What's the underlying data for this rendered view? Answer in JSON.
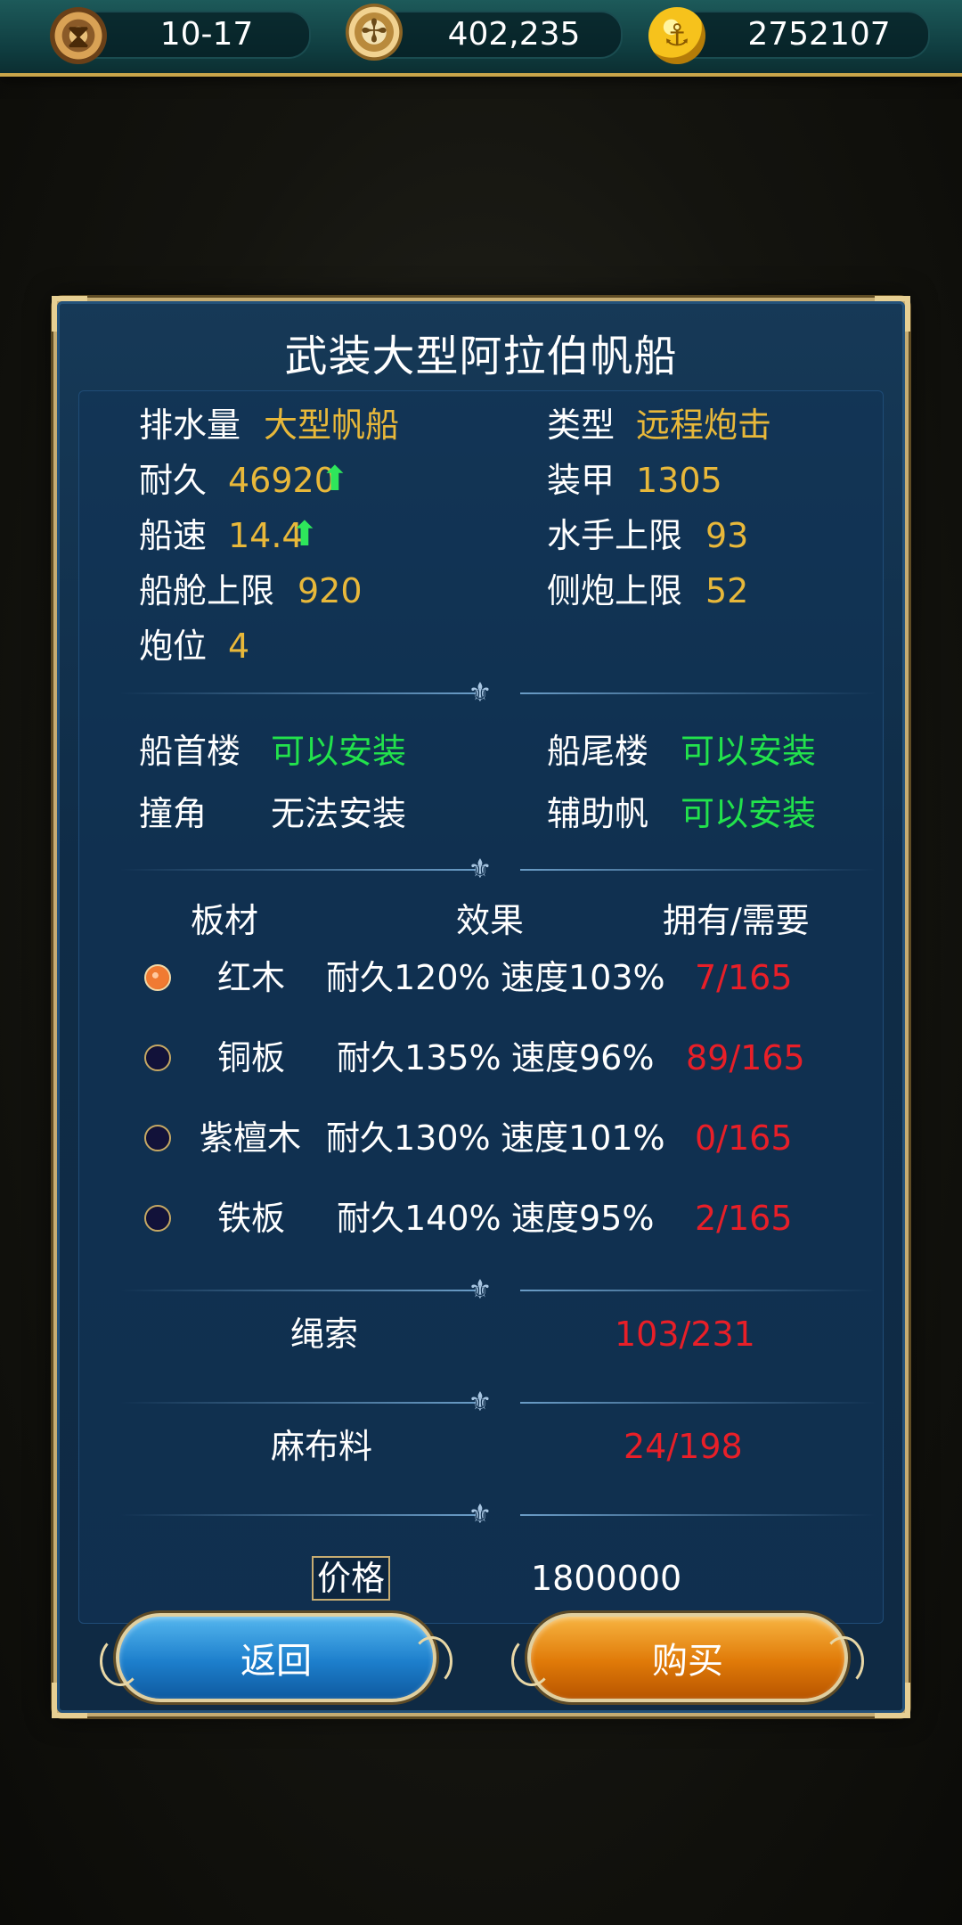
{
  "topbar": {
    "date": "10-17",
    "compass_value": "402,235",
    "gold": "2752107",
    "icons": [
      "hourglass-icon",
      "compass-icon",
      "gold-coin-icon"
    ]
  },
  "ship": {
    "title": "武装大型阿拉伯帆船",
    "stats": {
      "displacement_label": "排水量",
      "displacement_value": "大型帆船",
      "type_label": "类型",
      "type_value": "远程炮击",
      "durability_label": "耐久",
      "durability_value": "46920",
      "armor_label": "装甲",
      "armor_value": "1305",
      "speed_label": "船速",
      "speed_value": "14.4",
      "crew_label": "水手上限",
      "crew_value": "93",
      "cargo_label": "船舱上限",
      "cargo_value": "920",
      "side_cannon_label": "侧炮上限",
      "side_cannon_value": "52",
      "gun_slots_label": "炮位",
      "gun_slots_value": "4"
    },
    "equipment": {
      "bow_label": "船首楼",
      "bow_status": "可以安装",
      "stern_label": "船尾楼",
      "stern_status": "可以安装",
      "ram_label": "撞角",
      "ram_status": "无法安装",
      "aux_sail_label": "辅助帆",
      "aux_sail_status": "可以安装"
    },
    "planks": {
      "header_material": "板材",
      "header_effect": "效果",
      "header_owned": "拥有/需要",
      "rows": [
        {
          "name": "红木",
          "effect_dur": "耐久120%",
          "effect_spd": "速度103%",
          "count": "7/165",
          "selected": true
        },
        {
          "name": "铜板",
          "effect_dur": "耐久135%",
          "effect_spd": "速度96%",
          "count": "89/165",
          "selected": false
        },
        {
          "name": "紫檀木",
          "effect_dur": "耐久130%",
          "effect_spd": "速度101%",
          "count": "0/165",
          "selected": false
        },
        {
          "name": "铁板",
          "effect_dur": "耐久140%",
          "effect_spd": "速度95%",
          "count": "2/165",
          "selected": false
        }
      ]
    },
    "materials": [
      {
        "name": "绳索",
        "count": "103/231"
      },
      {
        "name": "麻布料",
        "count": "24/198"
      }
    ],
    "price_label": "价格",
    "price_value": "1800000"
  },
  "buttons": {
    "back": "返回",
    "buy": "购买"
  },
  "colors": {
    "value_yellow": "#e8b83a",
    "status_green": "#22e24c",
    "shortage_red": "#e81f28",
    "panel_bg": "#0f2c47",
    "frame_gold": "#c6ac72"
  }
}
